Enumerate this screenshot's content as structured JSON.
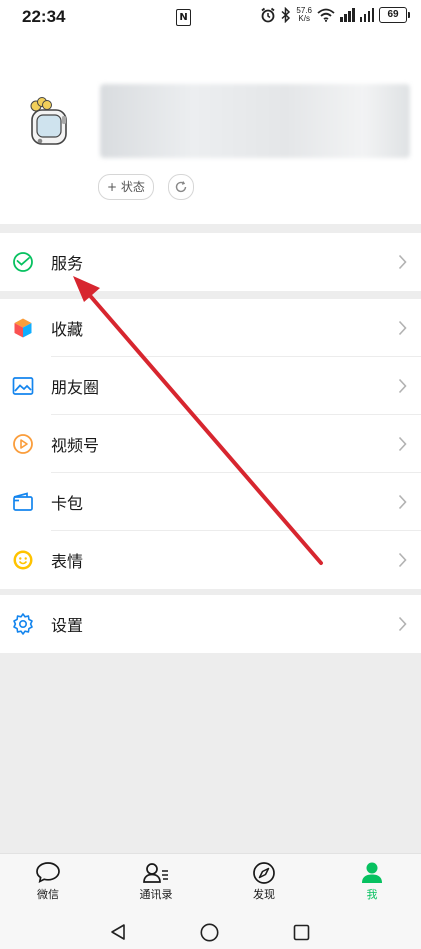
{
  "status_bar": {
    "time": "22:34",
    "nfc": "N",
    "net_speed_value": "57.6",
    "net_speed_unit": "K/s",
    "battery": "69"
  },
  "profile": {
    "status_button": "+ 状态"
  },
  "menu": {
    "service": "服务",
    "favorites": "收藏",
    "moments": "朋友圈",
    "channels": "视频号",
    "cards": "卡包",
    "stickers": "表情",
    "settings": "设置"
  },
  "tabbar": {
    "chats": "微信",
    "contacts": "通讯录",
    "discover": "发现",
    "me": "我"
  },
  "colors": {
    "accent": "#07c160",
    "annotation_arrow": "#d7262f"
  }
}
